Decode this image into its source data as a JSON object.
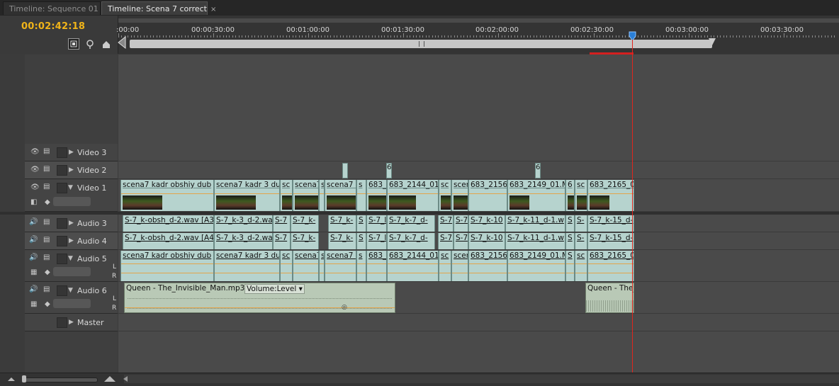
{
  "tabs": [
    {
      "label": "Timeline: Sequence 01",
      "active": false
    },
    {
      "label": "Timeline: Scena 7 correct",
      "active": true,
      "close": "×"
    }
  ],
  "timecode": "00:02:42:18",
  "ruler_labels": [
    ":00:00",
    "00:00:30:00",
    "00:01:00:00",
    "00:01:30:00",
    "00:02:00:00",
    "00:02:30:00",
    "00:03:00:00",
    "00:03:30:00"
  ],
  "tracks": {
    "video3": "Video 3",
    "video2": "Video 2",
    "video1": "Video 1",
    "audio3": "Audio 3",
    "audio4": "Audio 4",
    "audio5": "Audio 5",
    "audio6": "Audio 6",
    "master": "Master"
  },
  "lr": {
    "l": "L",
    "r": "R"
  },
  "markers": [
    "6",
    "6"
  ],
  "video1_clips": [
    "scena7 kadr obshiy dub",
    "scena7 kadr 3 du",
    "sc",
    "scena7",
    "s",
    "scena7 k",
    "s",
    "683_",
    "683_2144_01.",
    "sc",
    "scen",
    "683_2156",
    "683_2149_01.M",
    "6",
    "sc",
    "683_2165_0"
  ],
  "audio3_clips": [
    "S-7_k-obsh_d-2.wav [A3",
    "S-7_k-3_d-2.wa",
    "S-7",
    "S-7_k-",
    "S-7_k-",
    "S",
    "S-7_l",
    "S-7_k-7_d-",
    "S-7",
    "S-7",
    "S-7_k-10",
    "S-7_k-11_d-1.w",
    "S",
    "S-",
    "S-7_k-15_d-"
  ],
  "audio4_clips": [
    "S-7_k-obsh_d-2.wav [A4",
    "S-7_k-3_d-2.wa",
    "S-7",
    "S-7_k-",
    "S-7_k-",
    "S",
    "S-7_l",
    "S-7_k-7_d-",
    "S-7",
    "S-7",
    "S-7_k-10",
    "S-7_k-11_d-1.w",
    "S",
    "S-",
    "S-7_k-15_d-"
  ],
  "audio5_clips": [
    "scena7 kadr obshiy dub",
    "scena7 kadr 3 du",
    "sc",
    "scena7",
    "s",
    "scena7 k",
    "s",
    "683_",
    "683_2144_01.",
    "sc",
    "scen",
    "683_2156",
    "683_2149_01.M",
    "S",
    "sc",
    "683_2165_0"
  ],
  "audio6_clips": [
    {
      "name": "Queen - The_Invisible_Man.mp3",
      "volume": "Volume:Level"
    },
    {
      "name": "Queen - The_"
    }
  ],
  "colors": {
    "timecode": "#f0b419",
    "playhead": "#e0261e",
    "clip": "#b6d3ce",
    "audio_clip": "#b9c9b6"
  }
}
